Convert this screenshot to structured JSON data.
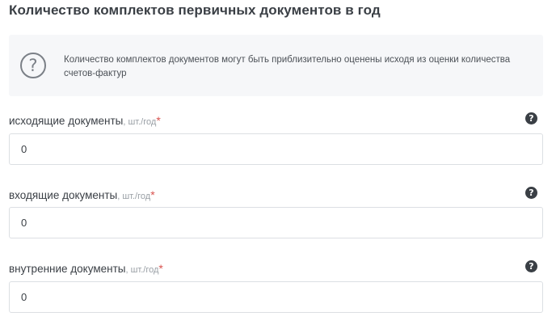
{
  "section": {
    "title": "Количество комплектов первичных документов в год"
  },
  "info": {
    "icon": "question-circle-icon",
    "text": "Количество комплектов документов могут быть приблизительно оценены исходя из оценки количества счетов-фактур"
  },
  "fields": [
    {
      "label": "исходящие документы",
      "unit": ", шт./год",
      "required_mark": "*",
      "value": "0",
      "help_icon": "help-circle-icon"
    },
    {
      "label": "входящие документы",
      "unit": ", шт./год",
      "required_mark": "*",
      "value": "0",
      "help_icon": "help-circle-icon"
    },
    {
      "label": "внутренние документы",
      "unit": ", шт./год",
      "required_mark": "*",
      "value": "0",
      "help_icon": "help-circle-icon"
    }
  ],
  "colors": {
    "text": "#3a3f45",
    "muted": "#9aa0a6",
    "required": "#d9534f",
    "info_bg": "#f6f7f9",
    "border": "#dcdfe3"
  }
}
